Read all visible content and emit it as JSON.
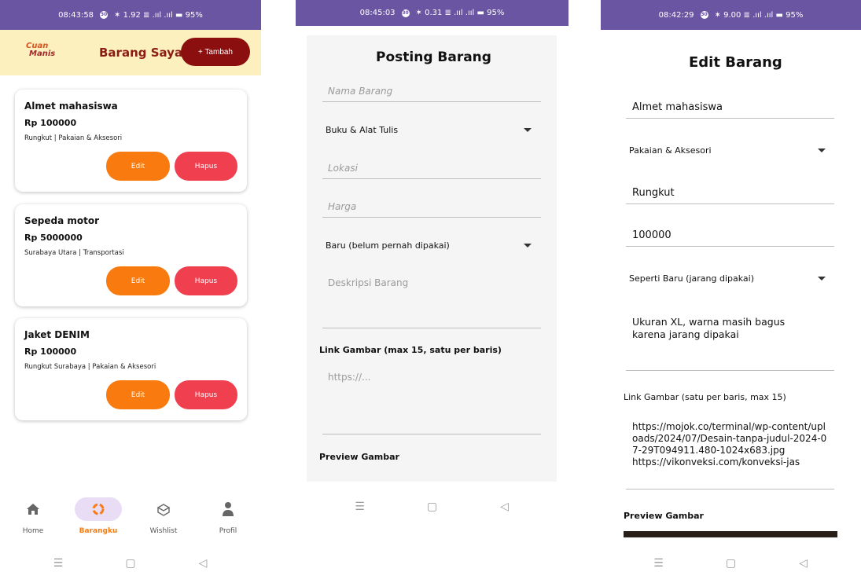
{
  "phone1": {
    "status": {
      "time": "08:43:58",
      "right": "✶ 1.92 ≣ .ııl .ııl ▬ 95%"
    },
    "logo": {
      "line1": "Cuan",
      "line2": "Manis"
    },
    "header": {
      "title": "Barang Saya",
      "add_label": "+ Tambah"
    },
    "items": [
      {
        "name": "Almet mahasiswa",
        "price": "Rp 100000",
        "meta": "Rungkut | Pakaian & Aksesori",
        "edit": "Edit",
        "delete": "Hapus"
      },
      {
        "name": "Sepeda motor",
        "price": "Rp 5000000",
        "meta": "Surabaya Utara | Transportasi",
        "edit": "Edit",
        "delete": "Hapus"
      },
      {
        "name": "Jaket DENIM",
        "price": "Rp 100000",
        "meta": "Rungkut Surabaya | Pakaian & Aksesori",
        "edit": "Edit",
        "delete": "Hapus"
      }
    ],
    "tabs": [
      {
        "label": "Home",
        "icon": "home-icon"
      },
      {
        "label": "Barangku",
        "icon": "recycle-icon"
      },
      {
        "label": "Wishlist",
        "icon": "gift-icon"
      },
      {
        "label": "Profil",
        "icon": "person-icon"
      }
    ],
    "active_tab": "Barangku"
  },
  "phone2": {
    "status": {
      "time": "08:45:03",
      "right": "✶ 0.31 ≣ .ııl .ııl ▬ 95%"
    },
    "title": "Posting Barang",
    "nama_placeholder": "Nama Barang",
    "category": "Buku & Alat Tulis",
    "lokasi_placeholder": "Lokasi",
    "harga_placeholder": "Harga",
    "condition": "Baru (belum pernah dipakai)",
    "deskripsi_placeholder": "Deskripsi Barang",
    "link_label": "Link Gambar (max 15, satu per baris)",
    "link_placeholder": "https://...",
    "preview_label": "Preview Gambar"
  },
  "phone3": {
    "status": {
      "time": "08:42:29",
      "right": "✶ 9.00 ≣ .ııl .ııl ▬ 95%"
    },
    "title": "Edit Barang",
    "nama": "Almet mahasiswa",
    "category": "Pakaian & Aksesori",
    "lokasi": "Rungkut",
    "harga": "100000",
    "condition": "Seperti Baru (jarang dipakai)",
    "deskripsi": "Ukuran XL, warna masih bagus karena jarang dipakai",
    "link_label": "Link Gambar (satu per baris, max 15)",
    "links": "https://mojok.co/terminal/wp-content/uploads/2024/07/Desain-tanpa-judul-2024-07-29T094911.480-1024x683.jpg\nhttps://vikonveksi.com/konveksi-jas",
    "preview_label": "Preview Gambar"
  }
}
